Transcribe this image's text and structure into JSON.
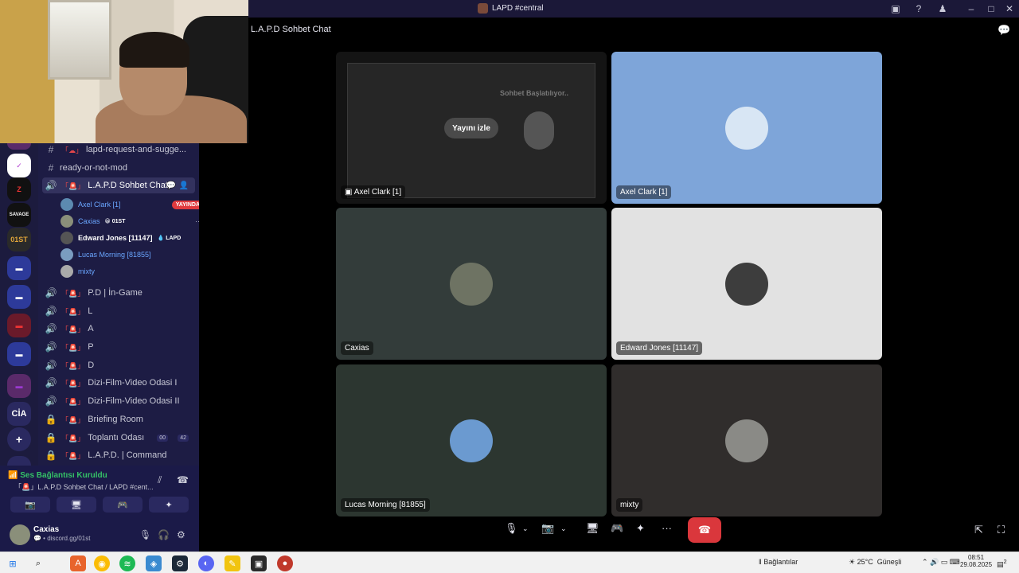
{
  "window": {
    "title": "LAPD #central"
  },
  "main": {
    "channel_title": "L.A.P.D Sohbet Chat",
    "watch_label": "Yayını izle",
    "tiles": [
      "Axel Clark [1]",
      "Axel Clark [1]",
      "Caxias",
      "Edward Jones [11147]",
      "Lucas Morning [81855]",
      "mixty"
    ],
    "stream_overlay": "Sohbet Başlatılıyor.."
  },
  "channels": {
    "text": [
      "lapd-request-and-sugge...",
      "ready-or-not-mod"
    ],
    "selected": "L.A.P.D Sohbet Chat",
    "members": [
      {
        "name": "Axel Clark [1]",
        "badge": "YAYINDA"
      },
      {
        "name": "Caxias",
        "tag": "01ST"
      },
      {
        "name": "Edward Jones [11147]",
        "tag": "LAPD"
      },
      {
        "name": "Lucas Morning [81855]"
      },
      {
        "name": "mixty"
      }
    ],
    "voice": [
      "P.D | İn-Game",
      "L",
      "A",
      "P",
      "D",
      "Dizi-Film-Video Odasi I",
      "Dizi-Film-Video Odasi II",
      "Briefing Room",
      "Toplantı Odası",
      "L.A.P.D. | Command"
    ],
    "meeting_counts": [
      "00",
      "42"
    ]
  },
  "rail": {
    "servers": [
      "Z",
      "SAVAGE",
      "01ST",
      "CİA"
    ]
  },
  "voice_panel": {
    "status": "Ses Bağlantısı Kuruldu",
    "channel": "L.A.P.D Sohbet Chat / LAPD #cent..."
  },
  "user": {
    "name": "Caxias",
    "status": "discord.gg/01st"
  },
  "taskbar": {
    "connections": "Bağlantılar",
    "weather": "25°C",
    "weather_desc": "Güneşli",
    "time": "08:51",
    "date": "29.08.2025",
    "notifications": "2"
  },
  "colors": {
    "accent": "#5865f2",
    "danger": "#da373c",
    "live": "#e03a3e",
    "connected": "#34c266"
  }
}
